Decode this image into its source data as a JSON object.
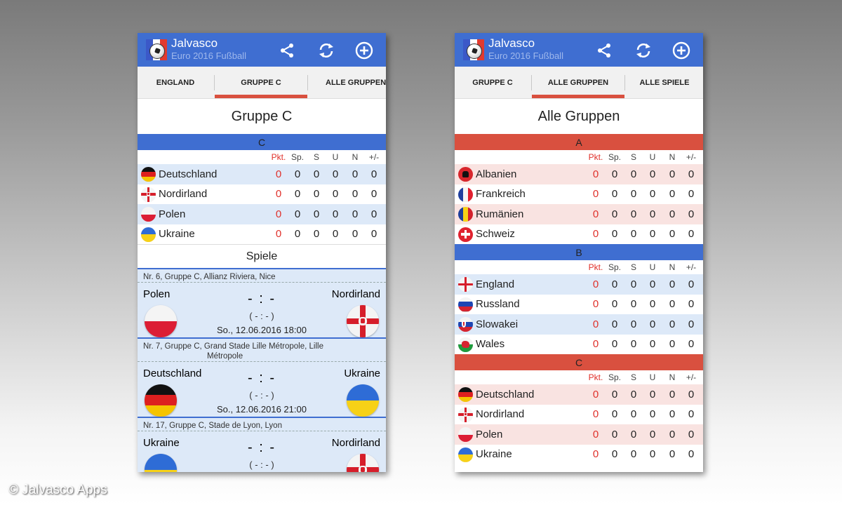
{
  "app": {
    "title": "Jalvasco",
    "subtitle": "Euro 2016 Fußball",
    "logo_flag_colors": [
      "#3b58c8",
      "#ffffff",
      "#e23a2f"
    ]
  },
  "icons": [
    "share-icon",
    "refresh-icon",
    "add-circle-icon"
  ],
  "colors": {
    "primary": "#3f6ed1",
    "accent": "#d9503f",
    "points": "#e0302a",
    "row_blue": "#dde9f8",
    "row_red": "#f9e3e1"
  },
  "copyright": "© Jalvasco Apps",
  "left": {
    "tabs": [
      "ENGLAND",
      "GRUPPE C",
      "ALLE GRUPPEN"
    ],
    "active_tab": 1,
    "page_title": "Gruppe C",
    "group": {
      "name": "C",
      "headers": [
        "Pkt.",
        "Sp.",
        "S",
        "U",
        "N",
        "+/-"
      ],
      "rows": [
        {
          "team": "Deutschland",
          "flag": "germany",
          "stats": [
            "0",
            "0",
            "0",
            "0",
            "0",
            "0"
          ]
        },
        {
          "team": "Nordirland",
          "flag": "northern-ireland",
          "stats": [
            "0",
            "0",
            "0",
            "0",
            "0",
            "0"
          ]
        },
        {
          "team": "Polen",
          "flag": "poland",
          "stats": [
            "0",
            "0",
            "0",
            "0",
            "0",
            "0"
          ]
        },
        {
          "team": "Ukraine",
          "flag": "ukraine",
          "stats": [
            "0",
            "0",
            "0",
            "0",
            "0",
            "0"
          ]
        }
      ]
    },
    "games_title": "Spiele",
    "matches": [
      {
        "info": "Nr. 6,  Gruppe C,  Allianz Riviera, Nice",
        "info2": "",
        "home": "Polen",
        "away": "Nordirland",
        "home_flag": "poland",
        "away_flag": "northern-ireland",
        "score": "- : -",
        "half": "( - : - )",
        "date": "So., 12.06.2016 18:00"
      },
      {
        "info": "Nr. 7,  Gruppe C,  Grand Stade Lille Métropole, Lille",
        "info2": "Métropole",
        "home": "Deutschland",
        "away": "Ukraine",
        "home_flag": "germany",
        "away_flag": "ukraine",
        "score": "- : -",
        "half": "( - : - )",
        "date": "So., 12.06.2016 21:00"
      },
      {
        "info": "Nr. 17,  Gruppe C,  Stade de Lyon, Lyon",
        "info2": "",
        "home": "Ukraine",
        "away": "Nordirland",
        "home_flag": "ukraine",
        "away_flag": "northern-ireland",
        "score": "- : -",
        "half": "( - : - )",
        "date": ""
      }
    ]
  },
  "right": {
    "tabs": [
      "GRUPPE C",
      "ALLE GRUPPEN",
      "ALLE SPIELE"
    ],
    "active_tab": 1,
    "page_title": "Alle Gruppen",
    "headers": [
      "Pkt.",
      "Sp.",
      "S",
      "U",
      "N",
      "+/-"
    ],
    "groups": [
      {
        "name": "A",
        "theme": "red",
        "rows": [
          {
            "team": "Albanien",
            "flag": "albania",
            "stats": [
              "0",
              "0",
              "0",
              "0",
              "0",
              "0"
            ]
          },
          {
            "team": "Frankreich",
            "flag": "france",
            "stats": [
              "0",
              "0",
              "0",
              "0",
              "0",
              "0"
            ]
          },
          {
            "team": "Rumänien",
            "flag": "romania",
            "stats": [
              "0",
              "0",
              "0",
              "0",
              "0",
              "0"
            ]
          },
          {
            "team": "Schweiz",
            "flag": "switzerland",
            "stats": [
              "0",
              "0",
              "0",
              "0",
              "0",
              "0"
            ]
          }
        ]
      },
      {
        "name": "B",
        "theme": "blue",
        "rows": [
          {
            "team": "England",
            "flag": "england",
            "stats": [
              "0",
              "0",
              "0",
              "0",
              "0",
              "0"
            ]
          },
          {
            "team": "Russland",
            "flag": "russia",
            "stats": [
              "0",
              "0",
              "0",
              "0",
              "0",
              "0"
            ]
          },
          {
            "team": "Slowakei",
            "flag": "slovakia",
            "stats": [
              "0",
              "0",
              "0",
              "0",
              "0",
              "0"
            ]
          },
          {
            "team": "Wales",
            "flag": "wales",
            "stats": [
              "0",
              "0",
              "0",
              "0",
              "0",
              "0"
            ]
          }
        ]
      },
      {
        "name": "C",
        "theme": "red",
        "rows": [
          {
            "team": "Deutschland",
            "flag": "germany",
            "stats": [
              "0",
              "0",
              "0",
              "0",
              "0",
              "0"
            ]
          },
          {
            "team": "Nordirland",
            "flag": "northern-ireland",
            "stats": [
              "0",
              "0",
              "0",
              "0",
              "0",
              "0"
            ]
          },
          {
            "team": "Polen",
            "flag": "poland",
            "stats": [
              "0",
              "0",
              "0",
              "0",
              "0",
              "0"
            ]
          },
          {
            "team": "Ukraine",
            "flag": "ukraine",
            "stats": [
              "0",
              "0",
              "0",
              "0",
              "0",
              "0"
            ]
          }
        ]
      }
    ]
  }
}
